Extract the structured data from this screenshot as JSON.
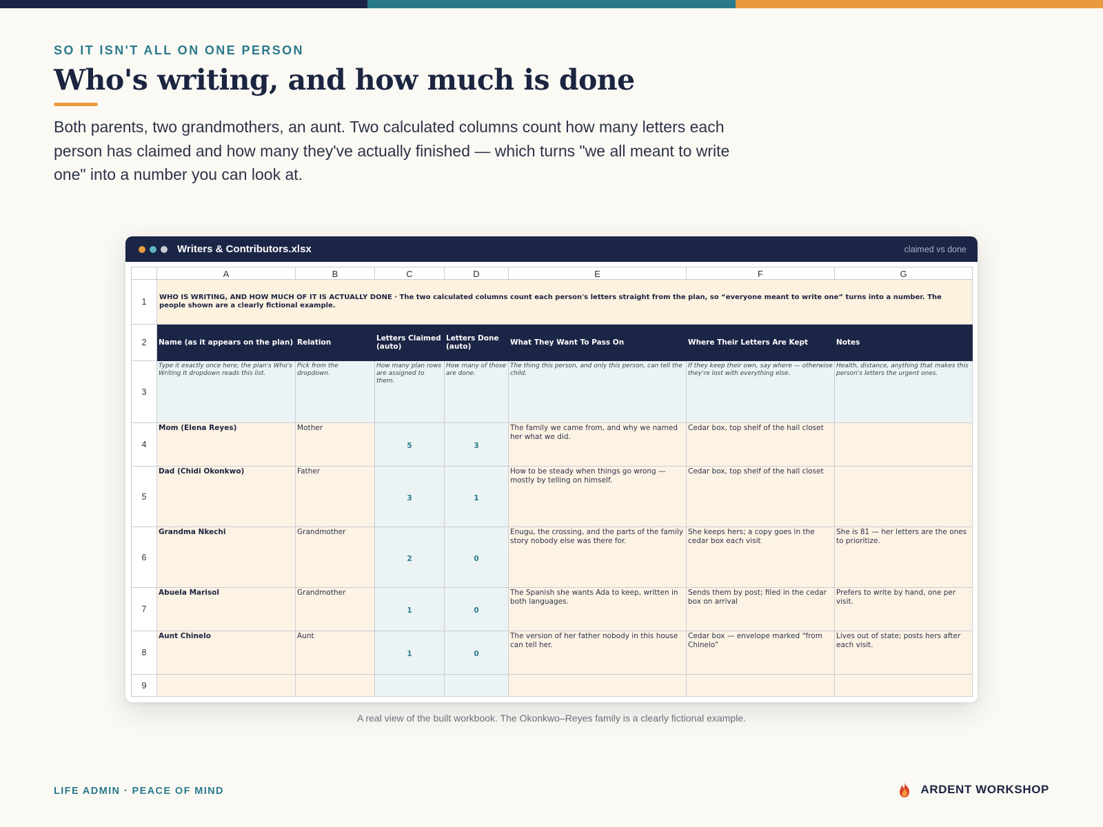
{
  "colors": {
    "navy": "#1b2545",
    "teal": "#2a7a8c",
    "orange": "#e99a3e",
    "cream": "#fbf9f4"
  },
  "eyebrow": "SO IT ISN'T ALL ON ONE PERSON",
  "headline": "Who's writing, and how much is done",
  "intro": "Both parents, two grandmothers, an aunt. Two calculated columns count how many letters each person has claimed and how many they've actually finished — which turns \"we all meant to write one\" into a number you can look at.",
  "window": {
    "title": "Writers & Contributors.xlsx",
    "tag": "claimed vs done"
  },
  "sheet": {
    "columns": [
      "A",
      "B",
      "C",
      "D",
      "E",
      "F",
      "G"
    ],
    "row_numbers": [
      "1",
      "2",
      "3",
      "4",
      "5",
      "6",
      "7",
      "8",
      "9"
    ],
    "banner": "WHO IS WRITING, AND HOW MUCH OF IT IS ACTUALLY DONE · The two calculated columns count each person's letters straight from the plan, so “everyone meant to write one” turns into a number. The people shown are a clearly fictional example.",
    "headers": [
      "Name (as it appears on the plan)",
      "Relation",
      "Letters Claimed (auto)",
      "Letters Done (auto)",
      "What They Want To Pass On",
      "Where Their Letters Are Kept",
      "Notes"
    ],
    "hints": [
      "Type it exactly once here; the plan's Who's Writing It dropdown reads this list.",
      "Pick from the dropdown.",
      "How many plan rows are assigned to them.",
      "How many of those are done.",
      "The thing this person, and only this person, can tell the child.",
      "If they keep their own, say where — otherwise they're lost with everything else.",
      "Health, distance, anything that makes this person's letters the urgent ones."
    ],
    "rows": [
      {
        "name": "Mom (Elena Reyes)",
        "relation": "Mother",
        "claimed": "5",
        "done": "3",
        "pass_on": "The family we came from, and why we named her what we did.",
        "kept": "Cedar box, top shelf of the hall closet",
        "notes": ""
      },
      {
        "name": "Dad (Chidi Okonkwo)",
        "relation": "Father",
        "claimed": "3",
        "done": "1",
        "pass_on": "How to be steady when things go wrong — mostly by telling on himself.",
        "kept": "Cedar box, top shelf of the hall closet",
        "notes": ""
      },
      {
        "name": "Grandma Nkechi",
        "relation": "Grandmother",
        "claimed": "2",
        "done": "0",
        "pass_on": "Enugu, the crossing, and the parts of the family story nobody else was there for.",
        "kept": "She keeps hers; a copy goes in the cedar box each visit",
        "notes": "She is 81 — her letters are the ones to prioritize."
      },
      {
        "name": "Abuela Marisol",
        "relation": "Grandmother",
        "claimed": "1",
        "done": "0",
        "pass_on": "The Spanish she wants Ada to keep, written in both languages.",
        "kept": "Sends them by post; filed in the cedar box on arrival",
        "notes": "Prefers to write by hand, one per visit."
      },
      {
        "name": "Aunt Chinelo",
        "relation": "Aunt",
        "claimed": "1",
        "done": "0",
        "pass_on": "The version of her father nobody in this house can tell her.",
        "kept": "Cedar box — envelope marked “from Chinelo”",
        "notes": "Lives out of state; posts hers after each visit."
      }
    ]
  },
  "caption": "A real view of the built workbook. The Okonkwo–Reyes family is a clearly fictional example.",
  "footer": {
    "left": "LIFE ADMIN · PEACE OF MIND",
    "brand": "ARDENT WORKSHOP",
    "brand_icon": "flame-icon"
  }
}
